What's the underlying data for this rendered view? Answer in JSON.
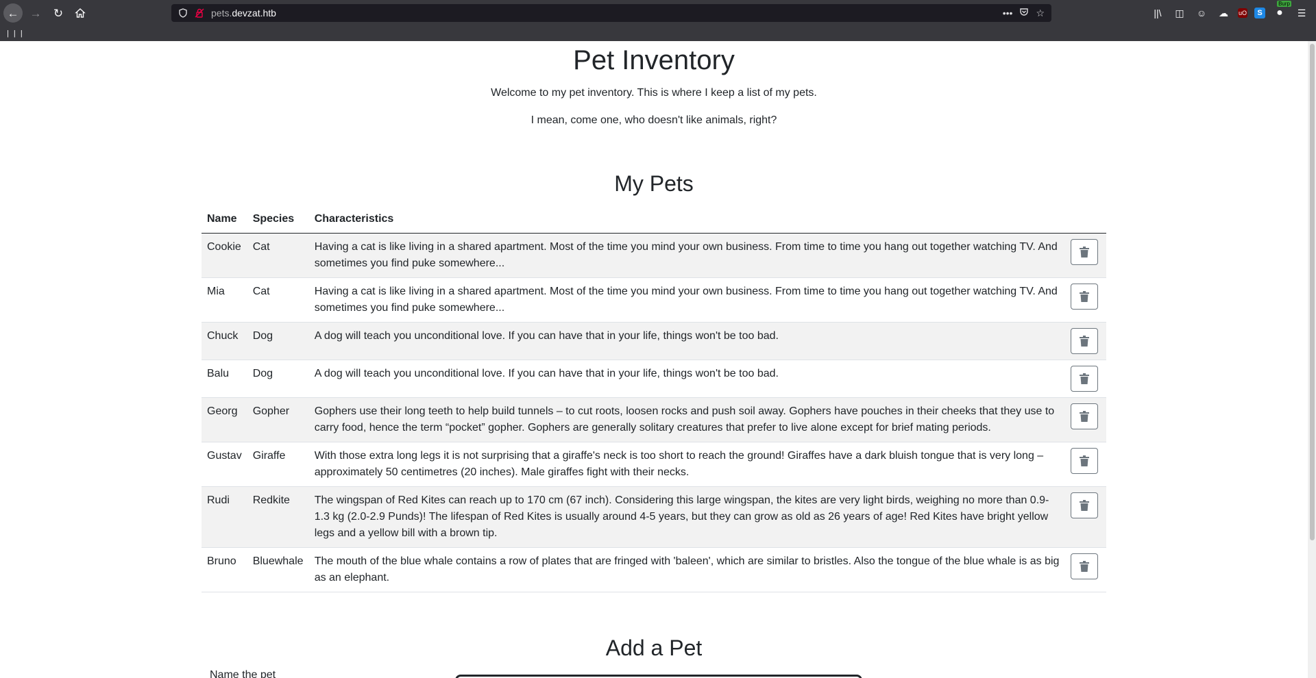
{
  "browser": {
    "url_host_prefix": "pets.",
    "url_host_domain": "devzat.htb",
    "bookmarks_text": "| | |",
    "burp_badge": "Burp"
  },
  "page": {
    "title": "Pet Inventory",
    "intro_1": "Welcome to my pet inventory. This is where I keep a list of my pets.",
    "intro_2": "I mean, come one, who doesn't like animals, right?",
    "pets_heading": "My Pets",
    "add_heading": "Add a Pet",
    "name_label": "Name the pet"
  },
  "table": {
    "headers": {
      "name": "Name",
      "species": "Species",
      "characteristics": "Characteristics"
    },
    "rows": [
      {
        "name": "Cookie",
        "species": "Cat",
        "characteristics": "Having a cat is like living in a shared apartment. Most of the time you mind your own business. From time to time you hang out together watching TV. And sometimes you find puke somewhere..."
      },
      {
        "name": "Mia",
        "species": "Cat",
        "characteristics": "Having a cat is like living in a shared apartment. Most of the time you mind your own business. From time to time you hang out together watching TV. And sometimes you find puke somewhere..."
      },
      {
        "name": "Chuck",
        "species": "Dog",
        "characteristics": "A dog will teach you unconditional love. If you can have that in your life, things won't be too bad."
      },
      {
        "name": "Balu",
        "species": "Dog",
        "characteristics": "A dog will teach you unconditional love. If you can have that in your life, things won't be too bad."
      },
      {
        "name": "Georg",
        "species": "Gopher",
        "characteristics": "Gophers use their long teeth to help build tunnels – to cut roots, loosen rocks and push soil away. Gophers have pouches in their cheeks that they use to carry food, hence the term “pocket” gopher. Gophers are generally solitary creatures that prefer to live alone except for brief mating periods."
      },
      {
        "name": "Gustav",
        "species": "Giraffe",
        "characteristics": "With those extra long legs it is not surprising that a giraffe's neck is too short to reach the ground! Giraffes have a dark bluish tongue that is very long – approximately 50 centimetres (20 inches). Male giraffes fight with their necks."
      },
      {
        "name": "Rudi",
        "species": "Redkite",
        "characteristics": "The wingspan of Red Kites can reach up to 170 cm (67 inch). Considering this large wingspan, the kites are very light birds, weighing no more than 0.9-1.3 kg (2.0-2.9 Punds)! The lifespan of Red Kites is usually around 4-5 years, but they can grow as old as 26 years of age! Red Kites have bright yellow legs and a yellow bill with a brown tip."
      },
      {
        "name": "Bruno",
        "species": "Bluewhale",
        "characteristics": "The mouth of the blue whale contains a row of plates that are fringed with 'baleen', which are similar to bristles. Also the tongue of the blue whale is as big as an elephant."
      }
    ]
  }
}
